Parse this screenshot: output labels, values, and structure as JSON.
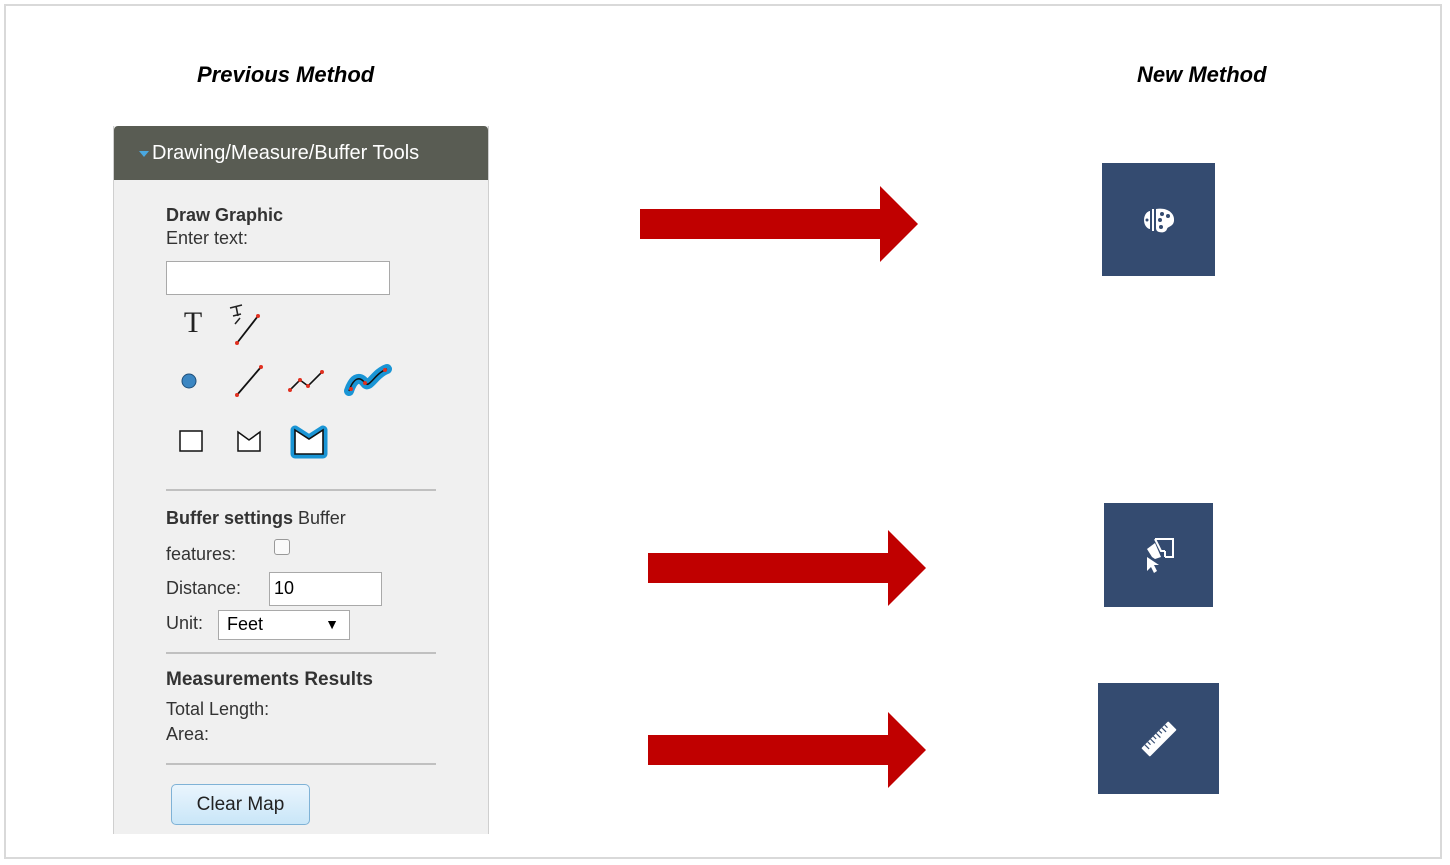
{
  "headings": {
    "previous": "Previous Method",
    "new": "New Method"
  },
  "panel": {
    "header_title": "Drawing/Measure/Buffer Tools",
    "draw_graphic_title": "Draw Graphic",
    "enter_text_label": "Enter text:",
    "text_tool_glyph": "T",
    "buffer_settings_title": "Buffer settings",
    "buffer_label_rest": "Buffer",
    "features_label": "features:",
    "distance_label": "Distance:",
    "distance_value": "10",
    "unit_label": "Unit:",
    "unit_value": "Feet",
    "unit_arrow": "▼",
    "measurements_title": "Measurements Results",
    "total_length_label": "Total Length:",
    "area_label": "Area:",
    "clear_button": "Clear Map"
  },
  "colors": {
    "arrow": "#c00000",
    "new_button_bg": "#344b70",
    "panel_header_bg": "#595c53"
  },
  "new_tools": [
    {
      "icon": "palette-icon"
    },
    {
      "icon": "select-cursor-icon"
    },
    {
      "icon": "ruler-icon"
    }
  ]
}
